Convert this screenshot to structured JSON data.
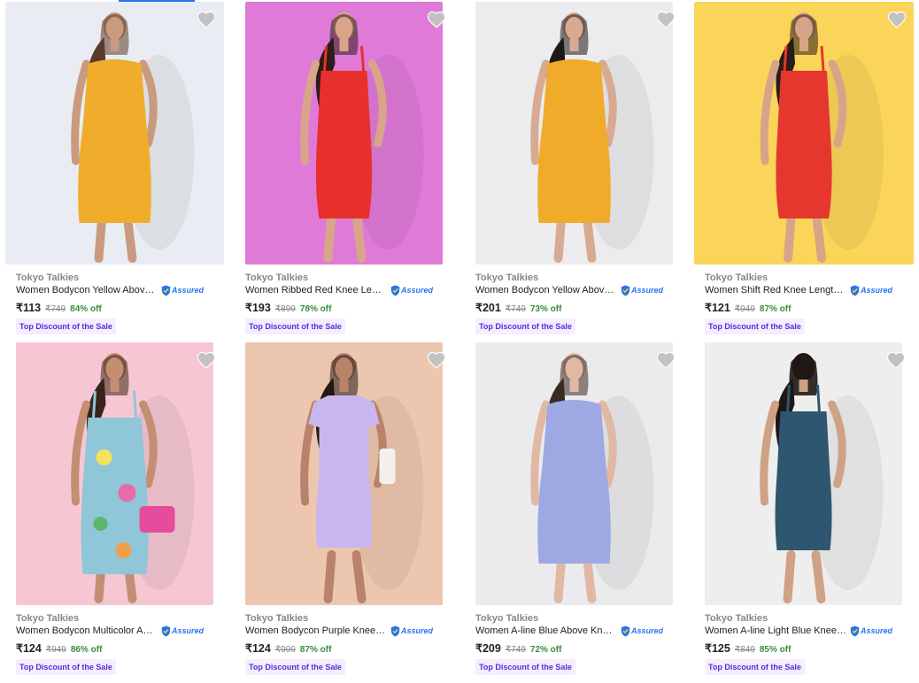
{
  "colors": {
    "accent": "#2874f0",
    "discount_green": "#388e3c",
    "badge_bg": "#f3efff",
    "badge_text": "#5a2bd9",
    "heart_gray": "#c2c2c2"
  },
  "assured_label": "Assured",
  "wishlist_icon": "heart-icon",
  "products": [
    {
      "brand": "Tokyo Talkies",
      "title": "Women Bodycon Yellow Above ...",
      "price": "₹113",
      "mrp": "₹749",
      "discount": "84% off",
      "badge": "Top Discount of the Sale",
      "image": {
        "bg": "#e9edf3",
        "dress": "#f0ad2b",
        "style": "sleeveless-short",
        "skin": "#c99a7e",
        "hair": "#5a3a2a"
      }
    },
    {
      "brand": "Tokyo Talkies",
      "title": "Women Ribbed Red Knee Lengt...",
      "price": "₹193",
      "mrp": "₹899",
      "discount": "78% off",
      "badge": "Top Discount of the Sale",
      "image": {
        "bg": "#e07ad8",
        "dress": "#e8302c",
        "style": "strappy-knee",
        "skin": "#d9a58a",
        "hair": "#2b1d18"
      }
    },
    {
      "brand": "Tokyo Talkies",
      "title": "Women Bodycon Yellow Above ...",
      "price": "₹201",
      "mrp": "₹749",
      "discount": "73% off",
      "badge": "Top Discount of the Sale",
      "image": {
        "bg": "#ececef",
        "dress": "#f0ab2a",
        "style": "sleeveless-short",
        "skin": "#d8aa92",
        "hair": "#1e1714"
      }
    },
    {
      "brand": "Tokyo Talkies",
      "title": "Women Shift Red Knee Length D...",
      "price": "₹121",
      "mrp": "₹949",
      "discount": "87% off",
      "badge": "Top Discount of the Sale",
      "image": {
        "bg": "#fbd55a",
        "dress": "#e5372e",
        "style": "strappy-knee",
        "skin": "#d7a487",
        "hair": "#2a1c16"
      }
    },
    {
      "brand": "Tokyo Talkies",
      "title": "Women Bodycon Multicolor Abo...",
      "price": "₹124",
      "mrp": "₹949",
      "discount": "86% off",
      "badge": "Top Discount of the Sale",
      "image": {
        "bg": "#f6c7d3",
        "dress": "#8fc6d8",
        "style": "strappy-short",
        "skin": "#c48e72",
        "hair": "#3a2418"
      }
    },
    {
      "brand": "Tokyo Talkies",
      "title": "Women Bodycon Purple Knee Le...",
      "price": "₹124",
      "mrp": "₹999",
      "discount": "87% off",
      "badge": "Top Discount of the Sale",
      "image": {
        "bg": "#edc6b0",
        "dress": "#c9b6ee",
        "style": "tshirt-knee",
        "skin": "#b9826a",
        "hair": "#231813"
      }
    },
    {
      "brand": "Tokyo Talkies",
      "title": "Women A-line Blue Above Knee/...",
      "price": "₹209",
      "mrp": "₹749",
      "discount": "72% off",
      "badge": "Top Discount of the Sale",
      "image": {
        "bg": "#ebebee",
        "dress": "#9ea9e3",
        "style": "sleeveless-short",
        "skin": "#e1b8a4",
        "hair": "#3a2a22"
      }
    },
    {
      "brand": "Tokyo Talkies",
      "title": "Women A-line Light Blue Knee L...",
      "price": "₹125",
      "mrp": "₹849",
      "discount": "85% off",
      "badge": "Top Discount of the Sale",
      "image": {
        "bg": "#eeeeee",
        "dress": "#2f5670",
        "style": "back-knee",
        "skin": "#cfa185",
        "hair": "#1f1714"
      }
    }
  ]
}
